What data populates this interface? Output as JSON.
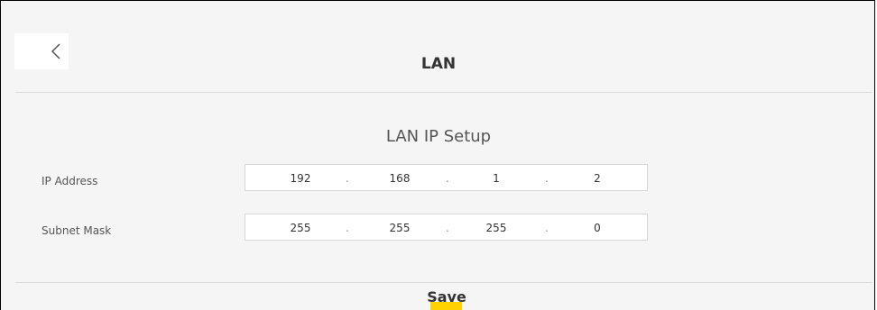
{
  "header": {
    "title": "LAN",
    "back_icon": "chevron-left-icon"
  },
  "section": {
    "title": "LAN IP Setup"
  },
  "ip_address": {
    "label": "IP Address",
    "octets": [
      "192",
      "168",
      "1",
      "2"
    ]
  },
  "subnet_mask": {
    "label": "Subnet Mask",
    "octets": [
      "255",
      "255",
      "255",
      "0"
    ]
  },
  "footer": {
    "save_label": "Save",
    "accent_color": "#ffd200"
  }
}
